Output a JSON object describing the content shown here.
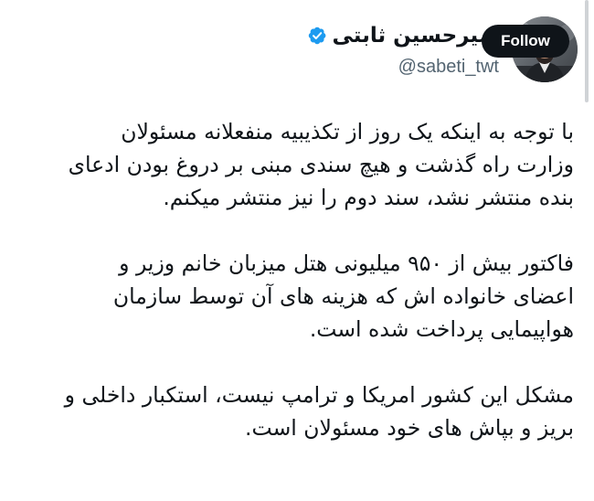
{
  "user": {
    "display_name": "امیرحسین ثابتی",
    "handle": "@sabeti_twt",
    "verified": true,
    "verified_color": "#1d9bf0"
  },
  "actions": {
    "follow_label": "Follow"
  },
  "tweet": {
    "paragraphs": [
      {
        "lines": [
          "با توجه به اینکه یک روز از تکذیبیه منفعلانه مسئولان",
          "وزارت راه گذشت و هیچ سندی مبنی بر دروغ بودن ادعای",
          "بنده منتشر نشد، سند دوم را نیز منتشر میکنم."
        ]
      },
      {
        "lines": [
          "فاکتور بیش از ۹۵۰ میلیونی هتل میزبان خانم وزیر و",
          "اعضای خانواده اش که هزینه های آن توسط سازمان",
          "هواپیمایی پرداخت شده است."
        ]
      },
      {
        "lines": [
          "مشکل این کشور امریکا و ترامپ نیست، استکبار داخلی و",
          "بریز و بپاش های خود مسئولان است."
        ]
      }
    ]
  },
  "colors": {
    "text": "#0f1419",
    "secondary_text": "#536471",
    "follow_bg": "#0f1419",
    "follow_text": "#ffffff"
  }
}
